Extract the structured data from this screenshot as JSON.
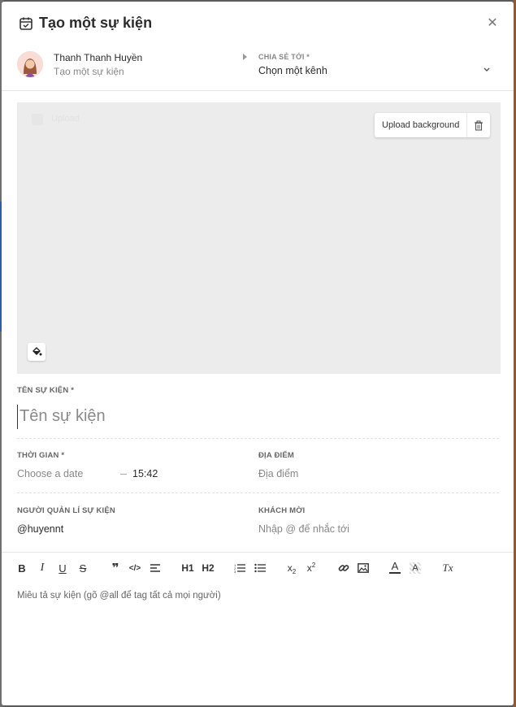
{
  "modal": {
    "title": "Tạo một sự kiện",
    "close_icon": "close-icon"
  },
  "author": {
    "name": "Thanh Thanh Huyền",
    "subtitle": "Tạo một sự kiện",
    "share_label": "CHIA SẺ TỚI *",
    "share_value": "Chọn một kênh"
  },
  "background": {
    "checkbox_label": "Upload",
    "upload_label": "Upload background",
    "trash_icon": "trash-icon",
    "fill_icon": "paint-bucket-icon"
  },
  "event_name": {
    "label": "TÊN SỰ KIỆN *",
    "placeholder": "Tên sự kiện"
  },
  "time": {
    "label": "THỜI GIAN *",
    "date_placeholder": "Choose a date",
    "time_value": "15:42"
  },
  "location": {
    "label": "ĐỊA ĐIỂM",
    "placeholder": "Địa điểm"
  },
  "manager": {
    "label": "NGƯỜI QUẢN LÍ SỰ KIỆN",
    "value": "@huyennt"
  },
  "guests": {
    "label": "KHÁCH MỜI",
    "placeholder": "Nhập @ để nhắc tới"
  },
  "toolbar": {
    "bold": "B",
    "italic": "I",
    "underline": "U",
    "strike": "S",
    "quote": "❞",
    "code": "</>",
    "align": "≡",
    "h1": "H1",
    "h2": "H2",
    "ordered_list": "1≡",
    "bullet_list": "•≡",
    "subscript": "x2",
    "superscript": "x2",
    "link": "link-icon",
    "image": "image-icon",
    "text_color": "A",
    "bg_color": "A",
    "clear_format": "Tx"
  },
  "description": {
    "placeholder": "Miêu tả sự kiện (gõ @all để tag tất cả mọi người)"
  },
  "colors": {
    "accent_text": "#2b2b2b",
    "muted_text": "#888888",
    "backdrop_blue": "#2d5fa8"
  }
}
